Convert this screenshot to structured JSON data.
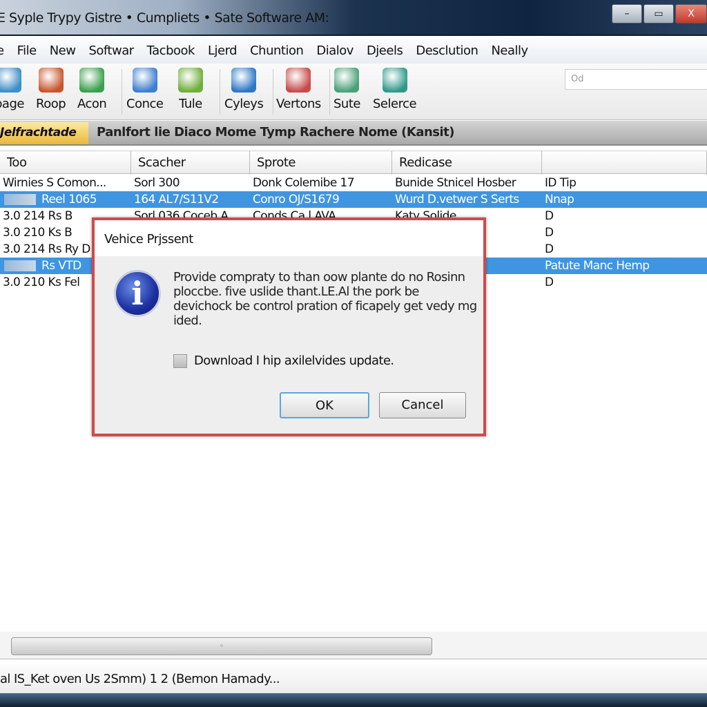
{
  "window": {
    "title": "E Syple Trypy Gistre • Cumpliets • Sate Software AM:",
    "minimize": "–",
    "maximize": "▭",
    "close": "X"
  },
  "menu": [
    "e",
    "File",
    "New",
    "Softwar",
    "Tacbook",
    "Ljerd",
    "Chuntion",
    "Dialov",
    "Djeels",
    "Desclution",
    "Neally"
  ],
  "toolbar": {
    "items": [
      {
        "label": "page",
        "icon": "download-icon",
        "color": "#3c8fc8"
      },
      {
        "label": "Roop",
        "icon": "globe-icon",
        "color": "#c8552c"
      },
      {
        "label": "Acon",
        "icon": "gem-icon",
        "color": "#3aa04a"
      },
      {
        "label": "Conce",
        "icon": "cursor-icon",
        "color": "#3e7fd0"
      },
      {
        "label": "Tule",
        "icon": "edit-icon",
        "color": "#6fae3a"
      },
      {
        "label": "Cyleys",
        "icon": "upload-icon",
        "color": "#2d78c8"
      },
      {
        "label": "Vertons",
        "icon": "tool-icon",
        "color": "#c84a4a"
      },
      {
        "label": "Sute",
        "icon": "folder-icon",
        "color": "#4aa07a"
      },
      {
        "label": "Selerce",
        "icon": "cube-icon",
        "color": "#2f9a8a"
      }
    ],
    "search_value": "Od"
  },
  "tabs": {
    "active": "Jelfrachtade",
    "title": "Panlfort lie Diaco Mome Tymp Rachere Nome (Kansit)"
  },
  "table": {
    "columns": [
      "Too",
      "Scacher",
      "Sprote",
      "Redicase",
      ""
    ],
    "rows": [
      {
        "cells": [
          "Wirnies S Comon...",
          "Sorl 300",
          "Donk Colemibe  17",
          "Bunide Stnicel Hosber",
          "ID Tip"
        ],
        "selected": false
      },
      {
        "cells": [
          "Reel 1065",
          "164 AL7/S11V2",
          "Conro OJ/S1679",
          "Wurd D.vetwer S Serts",
          "Nnap"
        ],
        "selected": true
      },
      {
        "cells": [
          "3.0 214 Rs B",
          "Sorl 036 Coceb A",
          "Conds Ca l AVA",
          "Katy Solide",
          "D"
        ],
        "selected": false
      },
      {
        "cells": [
          "3.0 210 Ks B",
          "",
          "",
          "",
          "D"
        ],
        "selected": false
      },
      {
        "cells": [
          "3.0 214 Rs Ry D",
          "",
          "",
          "",
          "D"
        ],
        "selected": false
      },
      {
        "cells": [
          "Rs VTD",
          "",
          "",
          "",
          "Patute Manc Hemp"
        ],
        "selected": true
      },
      {
        "cells": [
          "3.0 210 Ks Fel",
          "",
          "",
          "",
          "D"
        ],
        "selected": false
      }
    ]
  },
  "dialog": {
    "title": "Vehice Prjssent",
    "icon": "info-icon",
    "message": "Provide compraty to than oow plante do no Rosinn ploccbe. five uslide thant.LE.Al the pork be devichock be control pration of ficapely get vedy mg ided.",
    "checkbox_label": "Download I hip axilelvides update.",
    "checkbox_checked": false,
    "ok": "OK",
    "cancel": "Cancel"
  },
  "status": {
    "text": "al IS_Ket oven Us 2Smm) 1 2 (Bemon Hamady..."
  },
  "colors": {
    "selection": "#3f95e0",
    "dialog_border": "#d04a4a",
    "tab_active": "#e9b73c"
  }
}
